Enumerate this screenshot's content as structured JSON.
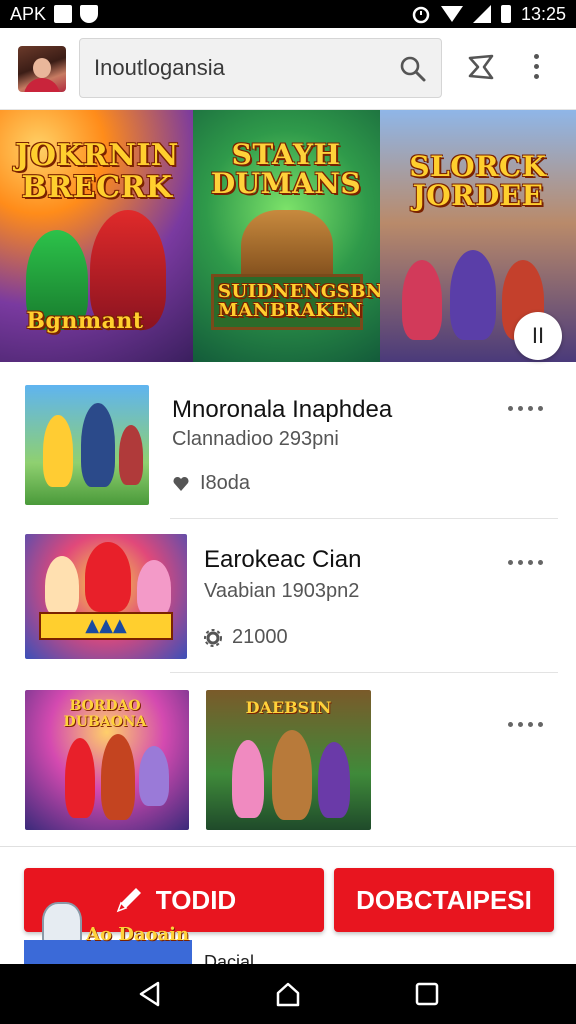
{
  "status_bar": {
    "app_label": "APK",
    "time": "13:25",
    "icons": [
      "image-icon",
      "shield-icon",
      "alarm-icon",
      "wifi-icon",
      "signal-icon",
      "battery-icon"
    ]
  },
  "header": {
    "search_value": "Inoutlogansia",
    "icons": [
      "avatar",
      "search-icon",
      "share-icon",
      "more-vert-icon"
    ]
  },
  "banner": {
    "slides": [
      {
        "title_top": "JOKRNIN BRECRK",
        "caption": "Bgnmant"
      },
      {
        "title_top": "STAYH DUMANS",
        "caption": "SUIDNENGSBN MANBRAKEN"
      },
      {
        "title_top": "SLORCK JORDEE"
      }
    ],
    "pause_label": "II"
  },
  "list": [
    {
      "title": "Mnoronala Inaphdea",
      "subtitle": "Clannadioo 293pni",
      "meta_icon": "heart-icon",
      "meta": "I8oda"
    },
    {
      "title": "Earokeac Cian",
      "subtitle": "Vaabian 1903pn2",
      "meta_icon": "gear-icon",
      "meta": "21000"
    },
    {
      "thumb1_caption": "BORDAO DUBAONA",
      "thumb2_caption": "DAEBSIN"
    }
  ],
  "buttons": {
    "primary": "TODID",
    "secondary": "DOBCTAIPESI"
  },
  "peek": {
    "mascot_caption": "Ao Daoain",
    "text": "Dacial"
  },
  "nav": [
    "back-icon",
    "home-icon",
    "recents-icon"
  ],
  "colors": {
    "accent": "#e8151f",
    "status_bar": "#000000"
  }
}
